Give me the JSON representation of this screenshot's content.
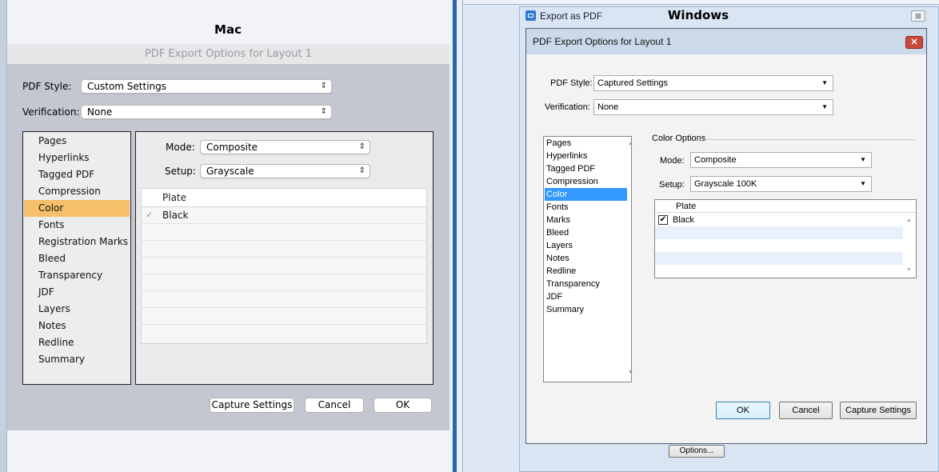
{
  "mac": {
    "heading": "Mac",
    "dialog_title": "PDF Export Options for Layout 1",
    "pdf_style": {
      "label": "PDF Style:",
      "value": "Custom Settings"
    },
    "verification": {
      "label": "Verification:",
      "value": "None"
    },
    "categories": [
      {
        "label": "Pages"
      },
      {
        "label": "Hyperlinks"
      },
      {
        "label": "Tagged PDF"
      },
      {
        "label": "Compression"
      },
      {
        "label": "Color",
        "selected": true
      },
      {
        "label": "Fonts"
      },
      {
        "label": "Registration Marks"
      },
      {
        "label": "Bleed"
      },
      {
        "label": "Transparency"
      },
      {
        "label": "JDF"
      },
      {
        "label": "Layers"
      },
      {
        "label": "Notes"
      },
      {
        "label": "Redline"
      },
      {
        "label": "Summary"
      }
    ],
    "mode": {
      "label": "Mode:",
      "value": "Composite"
    },
    "setup": {
      "label": "Setup:",
      "value": "Grayscale"
    },
    "plate_table": {
      "header": "Plate",
      "rows": [
        {
          "label": "Black",
          "checked": true
        }
      ]
    },
    "buttons": {
      "capture": "Capture Settings",
      "cancel": "Cancel",
      "ok": "OK"
    }
  },
  "windows": {
    "heading": "Windows",
    "outer_title": "Export as PDF",
    "outer_close": "⊠",
    "dialog_title": "PDF Export Options for Layout 1",
    "dialog_close": "✕",
    "pdf_style": {
      "label": "PDF Style:",
      "value": "Captured Settings"
    },
    "verification": {
      "label": "Verification:",
      "value": "None"
    },
    "categories": [
      {
        "label": "Pages"
      },
      {
        "label": "Hyperlinks"
      },
      {
        "label": "Tagged PDF"
      },
      {
        "label": "Compression"
      },
      {
        "label": "Color",
        "selected": true
      },
      {
        "label": "Fonts"
      },
      {
        "label": "Marks"
      },
      {
        "label": "Bleed"
      },
      {
        "label": "Layers"
      },
      {
        "label": "Notes"
      },
      {
        "label": "Redline"
      },
      {
        "label": "Transparency"
      },
      {
        "label": "JDF"
      },
      {
        "label": "Summary"
      }
    ],
    "color_options_title": "Color Options",
    "mode": {
      "label": "Mode:",
      "value": "Composite"
    },
    "setup": {
      "label": "Setup:",
      "value": "Grayscale 100K"
    },
    "plate_table": {
      "header": "Plate",
      "rows": [
        {
          "label": "Black",
          "checked": true
        }
      ]
    },
    "buttons": {
      "ok": "OK",
      "cancel": "Cancel",
      "capture": "Capture Settings"
    },
    "options_button": "Options..."
  }
}
